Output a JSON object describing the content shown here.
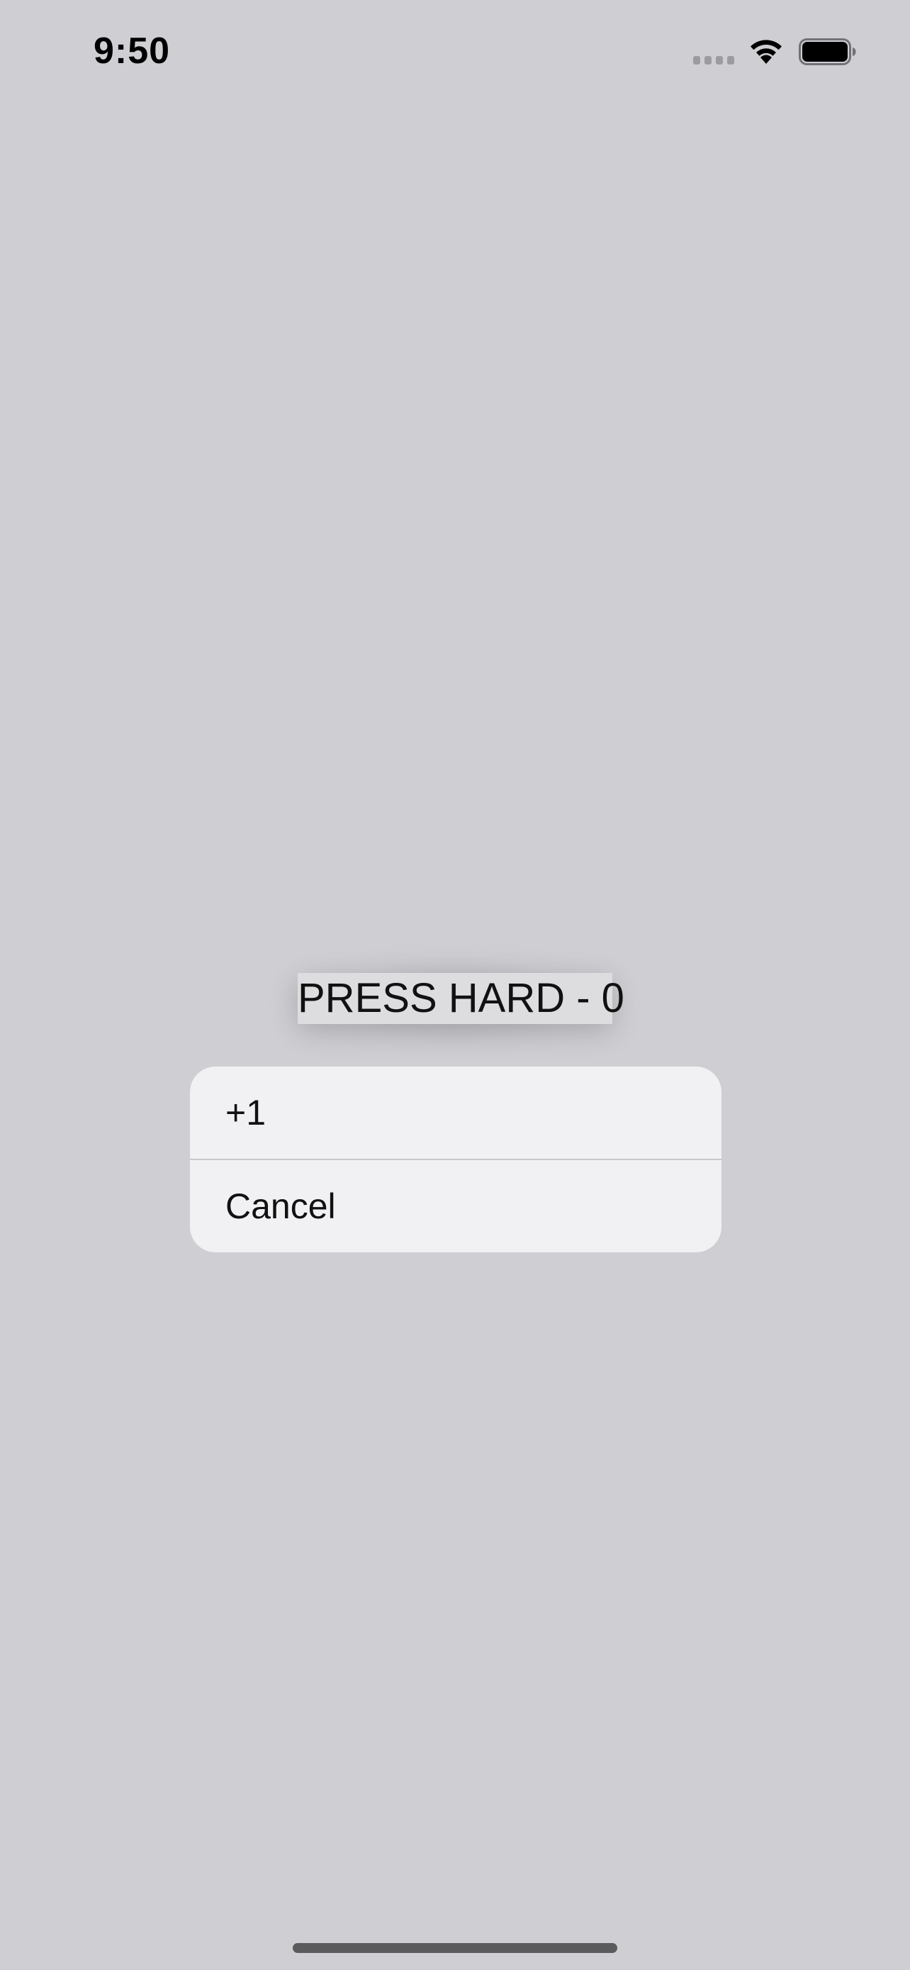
{
  "status_bar": {
    "time": "9:50",
    "icons": [
      "cellular-signal-icon",
      "wifi-icon",
      "battery-icon"
    ]
  },
  "main": {
    "press_label": "PRESS HARD - 0"
  },
  "action_menu": {
    "items": [
      {
        "label": "+1"
      },
      {
        "label": "Cancel"
      }
    ]
  },
  "colors": {
    "background": "#cfced3",
    "menu_background": "#f1f1f3",
    "text": "#111111"
  }
}
